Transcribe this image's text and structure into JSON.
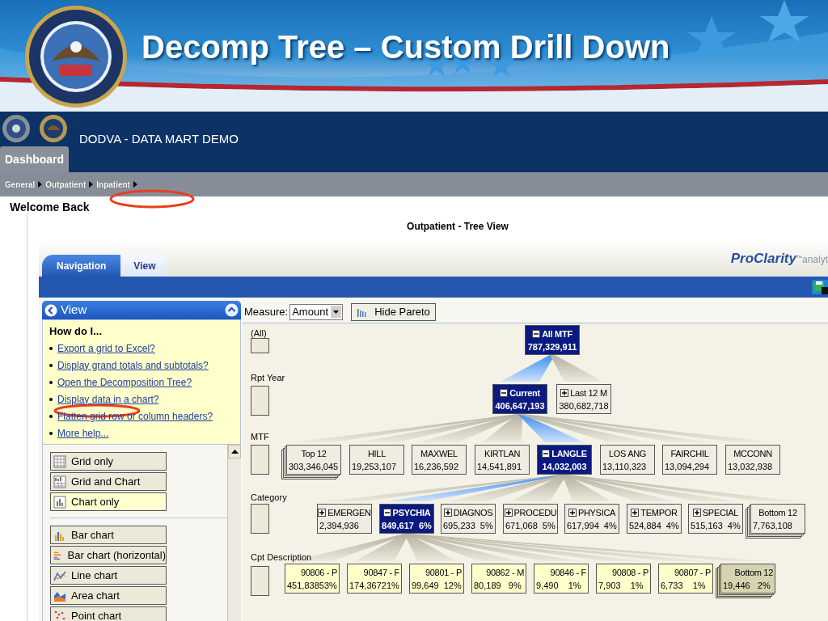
{
  "slide": {
    "title": "Decomp Tree – Custom Drill Down"
  },
  "app": {
    "title": "DODVA - DATA MART DEMO",
    "tabs": [
      {
        "label": "Dashboard",
        "selected": true
      }
    ],
    "breadcrumb": [
      "General",
      "Outpatient",
      "Inpatient"
    ],
    "greeting": "Welcome Back"
  },
  "report": {
    "title": "Outpatient - Tree View",
    "tabs": [
      {
        "label": "Navigation",
        "selected": false
      },
      {
        "label": "View",
        "selected": true
      }
    ],
    "logo": {
      "name": "ProClarity",
      "mark": "™",
      "tagline": "analyt"
    },
    "panel": {
      "title": "View",
      "help_heading": "How do I...",
      "help_links": [
        "Export a grid to Excel?",
        "Display grand totals and subtotals?",
        "Open the Decomposition Tree?",
        "Display data in a chart?",
        "Flatten grid row or column headers?",
        "More help..."
      ],
      "layout_buttons": [
        {
          "label": "Grid only",
          "kind": "grid",
          "selected": false
        },
        {
          "label": "Grid and Chart",
          "kind": "gridchart",
          "selected": false
        },
        {
          "label": "Chart only",
          "kind": "chart",
          "selected": true
        }
      ],
      "chart_buttons": [
        {
          "label": "Bar chart",
          "kind": "bar",
          "selected": false
        },
        {
          "label": "Bar chart (horizontal)",
          "kind": "hbar",
          "selected": false
        },
        {
          "label": "Line chart",
          "kind": "line",
          "selected": false
        },
        {
          "label": "Area chart",
          "kind": "area",
          "selected": false
        },
        {
          "label": "Point chart",
          "kind": "point",
          "selected": false
        }
      ]
    },
    "toolbar": {
      "measure_label": "Measure:",
      "measure_value": "Amount",
      "pareto_button": "Hide Pareto"
    },
    "tree": {
      "levels": [
        "(All)",
        "Rpt Year",
        "MTF",
        "Category",
        "Cpt Description"
      ],
      "root": {
        "label": "All MTF",
        "value": "787,329,911",
        "kind": "member",
        "selected": true,
        "expanded": true,
        "children": [
          {
            "label": "Current",
            "value": "406,647,193",
            "kind": "member",
            "selected": true,
            "expanded": true,
            "children": [
              {
                "label": "Top 12",
                "value": "303,346,045",
                "kind": "stack",
                "selected": false
              },
              {
                "label": "HILL",
                "value": "19,253,107",
                "kind": "member",
                "selected": false
              },
              {
                "label": "MAXWEL",
                "value": "16,236,592",
                "kind": "member",
                "selected": false
              },
              {
                "label": "KIRTLAN",
                "value": "14,541,891",
                "kind": "member",
                "selected": false
              },
              {
                "label": "LANGLE",
                "value": "14,032,003",
                "kind": "member",
                "selected": true,
                "expanded": true,
                "children": [
                  {
                    "label": "EMERGEN",
                    "value": "2,394,936",
                    "kind": "member",
                    "selected": false,
                    "expanded": false
                  },
                  {
                    "label": "PSYCHIA",
                    "value": "849,617  6%",
                    "kind": "member",
                    "selected": true,
                    "expanded": true,
                    "children": [
                      {
                        "label": "90806 - P",
                        "value": "451,83853%",
                        "kind": "member",
                        "selected": false
                      },
                      {
                        "label": "90847 - F",
                        "value": "174,36721%",
                        "kind": "member",
                        "selected": false
                      },
                      {
                        "label": "90801 - P",
                        "value": "99,649  12%",
                        "kind": "member",
                        "selected": false
                      },
                      {
                        "label": "90862 - M",
                        "value": "80,189   9%",
                        "kind": "member",
                        "selected": false
                      },
                      {
                        "label": "90846 - F",
                        "value": "9,490    1%",
                        "kind": "member",
                        "selected": false
                      },
                      {
                        "label": "90808 - P",
                        "value": "7,903    1%",
                        "kind": "member",
                        "selected": false
                      },
                      {
                        "label": "90807 - P",
                        "value": "6,733    1%",
                        "kind": "member",
                        "selected": false
                      },
                      {
                        "label": "Bottom 12",
                        "value": "19,446   2%",
                        "kind": "stack",
                        "selected": false
                      }
                    ]
                  },
                  {
                    "label": "DIAGNOS",
                    "value": "695,233  5%",
                    "kind": "member",
                    "selected": false,
                    "expanded": false
                  },
                  {
                    "label": "PROCEDU",
                    "value": "671,068  5%",
                    "kind": "member",
                    "selected": false,
                    "expanded": false
                  },
                  {
                    "label": "PHYSICA",
                    "value": "617,994  4%",
                    "kind": "member",
                    "selected": false,
                    "expanded": false
                  },
                  {
                    "label": "TEMPOR",
                    "value": "524,884  4%",
                    "kind": "member",
                    "selected": false,
                    "expanded": false
                  },
                  {
                    "label": "SPECIAL",
                    "value": "515,163  4%",
                    "kind": "member",
                    "selected": false,
                    "expanded": false
                  },
                  {
                    "label": "Bottom 12",
                    "value": "7,763,108",
                    "kind": "stack",
                    "selected": false
                  }
                ]
              },
              {
                "label": "LOS ANG",
                "value": "13,110,323",
                "kind": "member",
                "selected": false
              },
              {
                "label": "FAIRCHIL",
                "value": "13,094,294",
                "kind": "member",
                "selected": false
              },
              {
                "label": "MCCONN",
                "value": "13,032,938",
                "kind": "member",
                "selected": false
              }
            ]
          },
          {
            "label": "Last 12 M",
            "value": "380,682,718",
            "kind": "member",
            "selected": false,
            "expanded": false
          }
        ]
      }
    }
  },
  "annotations": [
    {
      "kind": "ellipse"
    },
    {
      "kind": "ellipse"
    }
  ]
}
